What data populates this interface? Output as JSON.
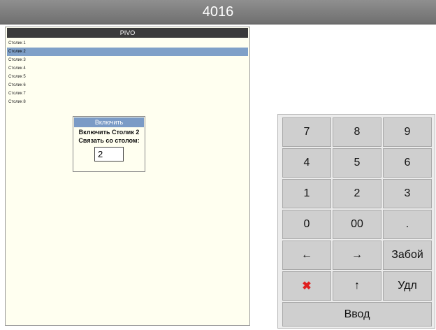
{
  "window": {
    "title": "4016"
  },
  "panel": {
    "title": "PIVO",
    "tables": [
      {
        "label": "Столик 1"
      },
      {
        "label": "Столик 2"
      },
      {
        "label": "Столик 3"
      },
      {
        "label": "Столик 4"
      },
      {
        "label": "Столик 5"
      },
      {
        "label": "Столик 6"
      },
      {
        "label": "Столик 7"
      },
      {
        "label": "Столик 8"
      }
    ],
    "selected_index": 1
  },
  "dialog": {
    "title": "Включить",
    "line1": "Включить Столик 2",
    "line2": "Связать со столом:",
    "input_value": "2"
  },
  "keypad": {
    "keys": [
      "7",
      "8",
      "9",
      "4",
      "5",
      "6",
      "1",
      "2",
      "3",
      "0",
      "00",
      ".",
      "←",
      "→",
      "Забой",
      "✖",
      "↑",
      "Удл",
      "Ввод"
    ],
    "icons": {
      "cancel": "red-x-icon"
    }
  }
}
